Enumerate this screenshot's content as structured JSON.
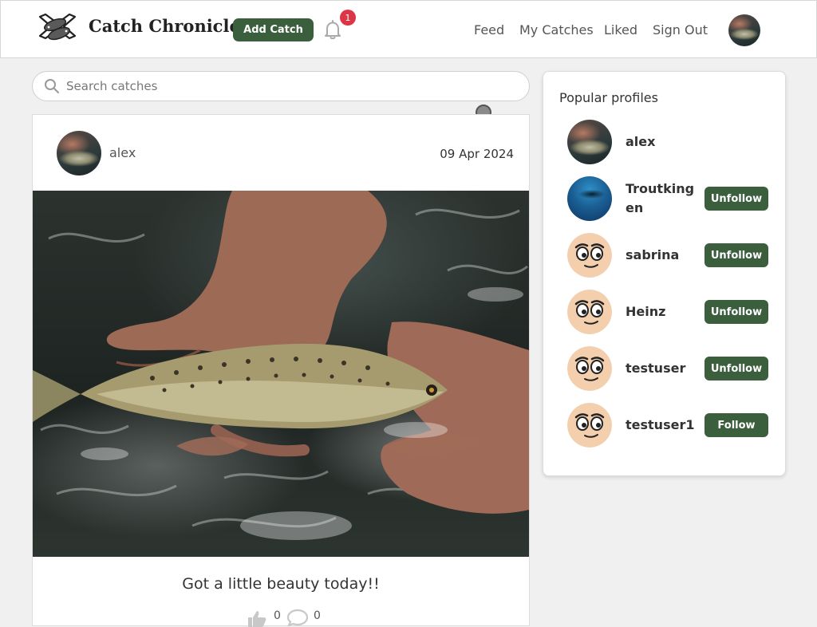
{
  "header": {
    "brand": "Catch Chronicle",
    "add_catch_label": "Add Catch",
    "notification_count": "1",
    "nav": [
      {
        "label": "Feed"
      },
      {
        "label": "My Catches"
      },
      {
        "label": "Liked"
      },
      {
        "label": "Sign Out"
      }
    ]
  },
  "search": {
    "placeholder": "Search catches",
    "value": ""
  },
  "post": {
    "username": "alex",
    "date": "09 Apr 2024",
    "title": "Got a little beauty today!!",
    "likes": "0",
    "comments": "0"
  },
  "popular": {
    "title": "Popular profiles",
    "profiles": [
      {
        "name": "alex",
        "button": ""
      },
      {
        "name": "Troutkingen",
        "button": "Unfollow"
      },
      {
        "name": "sabrina",
        "button": "Unfollow"
      },
      {
        "name": "Heinz",
        "button": "Unfollow"
      },
      {
        "name": "testuser",
        "button": "Unfollow"
      },
      {
        "name": "testuser1",
        "button": "Follow"
      }
    ]
  },
  "colors": {
    "accent": "#3b5e3d",
    "badge": "#dc3545",
    "background": "#f0f0f0"
  }
}
